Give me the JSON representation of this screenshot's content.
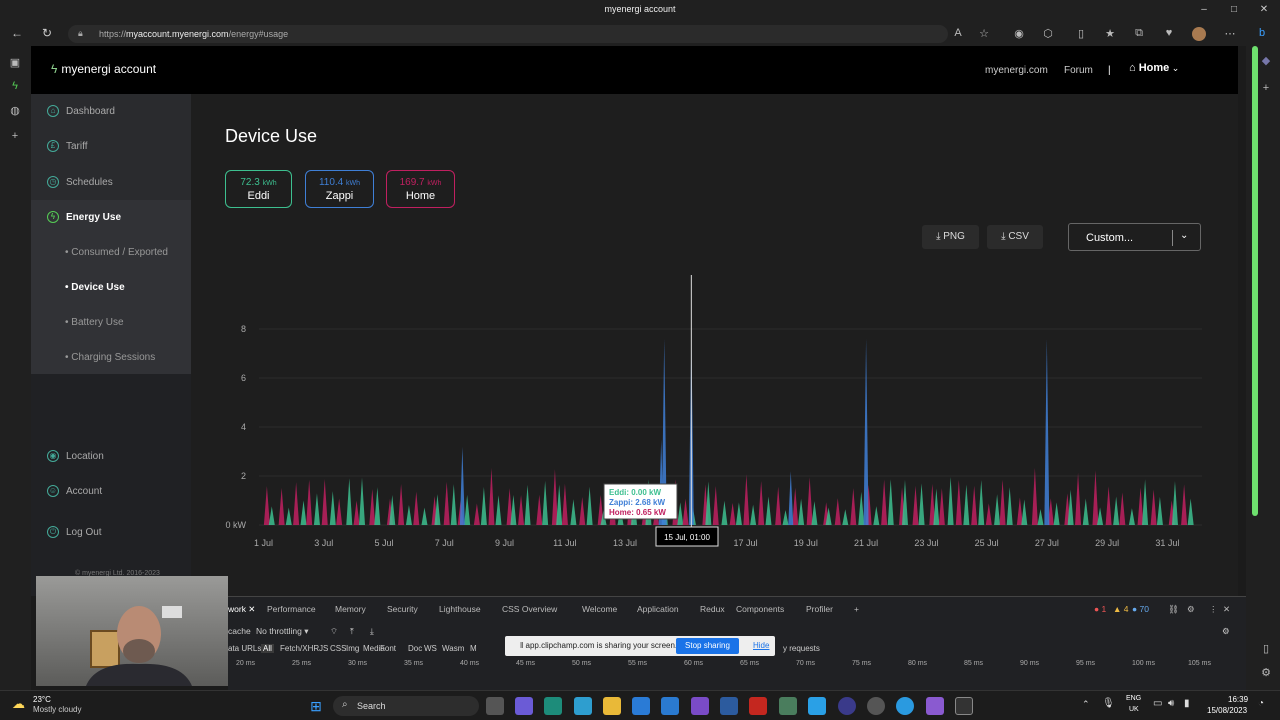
{
  "window": {
    "title": "myenergi account"
  },
  "browser": {
    "url_prefix": "https://",
    "url_domain": "myaccount.myenergi.com",
    "url_path": "/energy#usage"
  },
  "site": {
    "logo_text": "myenergi account",
    "nav": {
      "link1": "myenergi.com",
      "link2": "Forum",
      "separator": "|",
      "home": "Home"
    }
  },
  "sidebar": {
    "items": [
      {
        "label": "Dashboard"
      },
      {
        "label": "Tariff"
      },
      {
        "label": "Schedules"
      },
      {
        "label": "Energy Use"
      },
      {
        "label": "Location"
      },
      {
        "label": "Account"
      },
      {
        "label": "Log Out"
      }
    ],
    "sub_items": [
      {
        "label": "• Consumed / Exported"
      },
      {
        "label": "• Device Use"
      },
      {
        "label": "• Battery Use"
      },
      {
        "label": "• Charging Sessions"
      }
    ],
    "footer": "© myenergi Ltd. 2016-2023"
  },
  "main": {
    "title": "Device Use",
    "devices": [
      {
        "value": "72.3",
        "unit": "kWh",
        "name": "Eddi",
        "color": "#3dbf8f"
      },
      {
        "value": "110.4",
        "unit": "kWh",
        "name": "Zappi",
        "color": "#3f7fd6"
      },
      {
        "value": "169.7",
        "unit": "kWh",
        "name": "Home",
        "color": "#c02060"
      }
    ],
    "export_png": "PNG",
    "export_csv": "CSV",
    "range": "Custom..."
  },
  "chart_data": {
    "type": "area",
    "x_tick_labels": [
      "1 Jul",
      "3 Jul",
      "5 Jul",
      "7 Jul",
      "9 Jul",
      "11 Jul",
      "13 Jul",
      "15 Jul",
      "17 Jul",
      "19 Jul",
      "21 Jul",
      "23 Jul",
      "25 Jul",
      "27 Jul",
      "29 Jul",
      "31 Jul"
    ],
    "y_tick_labels": [
      "0 kW",
      "2",
      "4",
      "6",
      "8"
    ],
    "ylim": [
      0,
      8
    ],
    "series": [
      {
        "name": "Eddi",
        "color": "#3dbf8f"
      },
      {
        "name": "Zappi",
        "color": "#3f7fd6"
      },
      {
        "name": "Home",
        "color": "#c02060"
      }
    ],
    "zappi_spikes": [
      [
        14.3,
        7.6
      ],
      [
        15.2,
        7.8
      ],
      [
        21.0,
        7.6
      ],
      [
        27.0,
        7.6
      ],
      [
        7.6,
        3.2
      ],
      [
        14.2,
        3.5
      ],
      [
        18.5,
        2.2
      ]
    ],
    "tooltip": {
      "eddi": "Eddi: 0.00 kW",
      "zappi": "Zappi: 2.68 kW",
      "home": "Home: 0.65 kW",
      "x_label": "15 Jul, 01:00"
    }
  },
  "devtools": {
    "tabs": [
      "work",
      "Performance",
      "Memory",
      "Security",
      "Lighthouse",
      "CSS Overview",
      "Welcome",
      "Application",
      "Redux",
      "Components",
      "Profiler"
    ],
    "errors": "1",
    "warnings": "4",
    "info": "70",
    "row2_cache": "cache",
    "row2_throttle": "No throttling",
    "filters": [
      "ata URLs",
      "All",
      "Fetch/XHR",
      "JS",
      "CSS",
      "Img",
      "Media",
      "Font",
      "Doc",
      "WS",
      "Wasm",
      "M"
    ],
    "filter_tail": "y requests",
    "timeline": [
      "20 ms",
      "25 ms",
      "30 ms",
      "35 ms",
      "40 ms",
      "45 ms",
      "50 ms",
      "55 ms",
      "60 ms",
      "65 ms",
      "70 ms",
      "75 ms",
      "80 ms",
      "85 ms",
      "90 ms",
      "95 ms",
      "100 ms",
      "105 ms"
    ]
  },
  "sharing": {
    "text": "app.clipchamp.com is sharing your screen.",
    "stop": "Stop sharing",
    "hide": "Hide"
  },
  "taskbar": {
    "weather_temp": "23°C",
    "weather_desc": "Mostly cloudy",
    "search": "Search",
    "lang1": "ENG",
    "lang2": "UK",
    "time": "16:39",
    "date": "15/08/2023"
  }
}
